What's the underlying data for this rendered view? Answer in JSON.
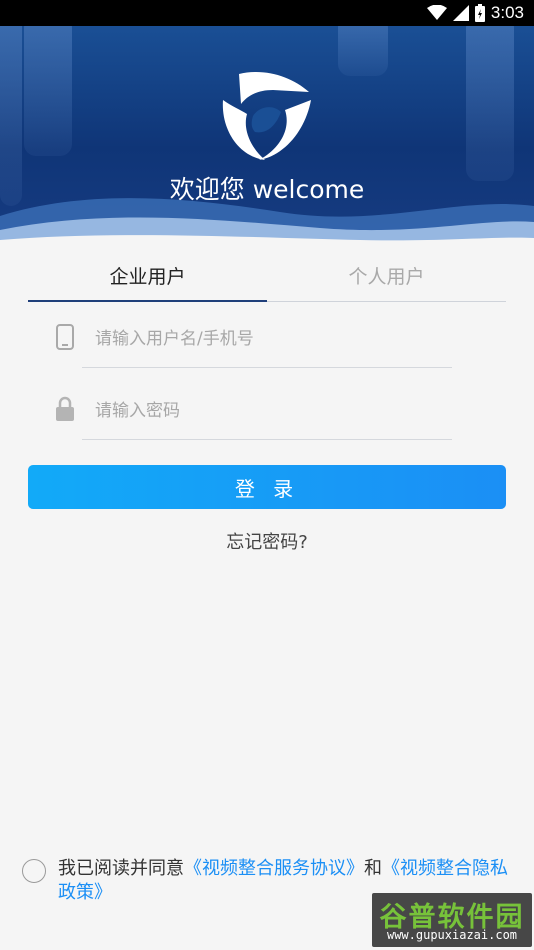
{
  "status_bar": {
    "time": "3:03"
  },
  "header": {
    "welcome_text": "欢迎您 welcome"
  },
  "tabs": [
    {
      "label": "企业用户",
      "active": true
    },
    {
      "label": "个人用户",
      "active": false
    }
  ],
  "form": {
    "username_placeholder": "请输入用户名/手机号",
    "password_placeholder": "请输入密码",
    "login_label": "登 录",
    "forgot_label": "忘记密码?"
  },
  "agreement": {
    "prefix": "我已阅读并同意",
    "service_link": "《视频整合服务协议》",
    "conjunction": "和",
    "privacy_link": "《视频整合隐私政策》"
  },
  "watermark": {
    "title": "谷普软件园",
    "url": "www.gupuxiazai.com"
  },
  "colors": {
    "accent": "#1b8ff5",
    "header_bg": "#0f3577",
    "tab_underline": "#1f3f7a"
  }
}
